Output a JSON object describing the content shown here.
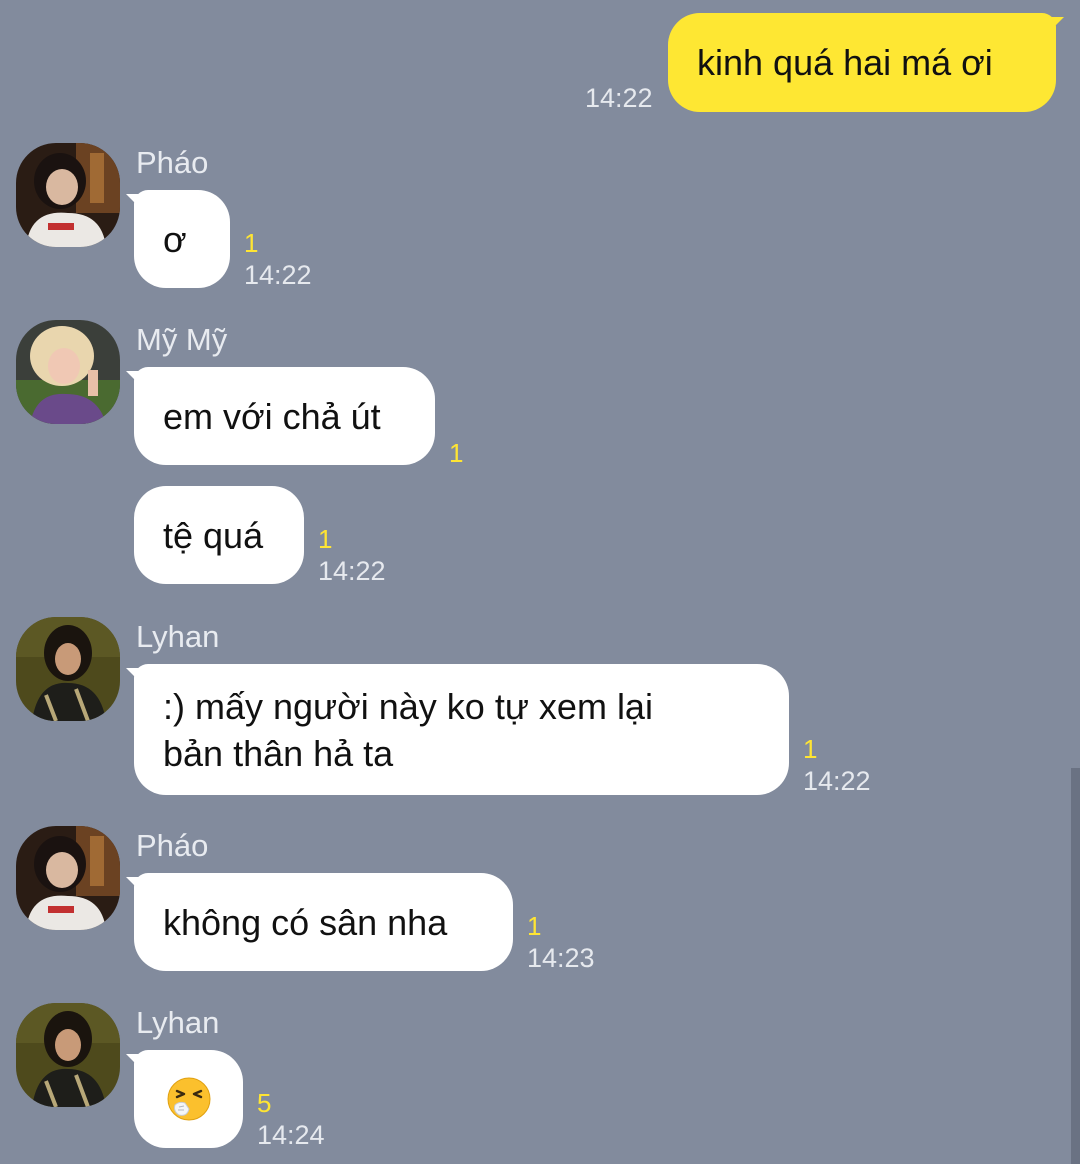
{
  "messages": [
    {
      "sender": "me",
      "text": "kinh quá hai má ơi",
      "time": "14:22"
    },
    {
      "sender": "Pháo",
      "text": "ơ",
      "unread": "1",
      "time": "14:22"
    },
    {
      "sender": "Mỹ Mỹ",
      "text": "em với chả út",
      "unread": "1"
    },
    {
      "sender": "Mỹ Mỹ",
      "text": "tệ quá",
      "unread": "1",
      "time": "14:22"
    },
    {
      "sender": "Lyhan",
      "lines": [
        ":) mấy người này ko tự xem lại",
        "bản thân hả ta"
      ],
      "unread": "1",
      "time": "14:22"
    },
    {
      "sender": "Pháo",
      "text": "không có sân nha",
      "unread": "1",
      "time": "14:23"
    },
    {
      "sender": "Lyhan",
      "emoji": "sneezing-face",
      "unread": "5",
      "time": "14:24"
    }
  ],
  "colors": {
    "background": "#828b9d",
    "my_bubble": "#fee733",
    "other_bubble": "#ffffff",
    "unread": "#ffe533"
  }
}
